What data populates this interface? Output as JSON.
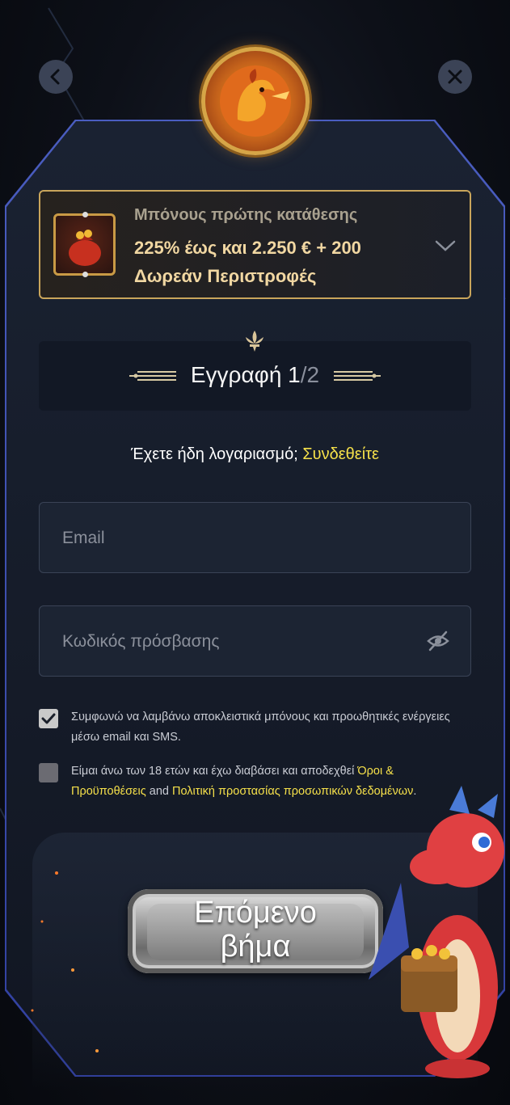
{
  "header": {
    "back_icon": "chevron-left-icon",
    "close_icon": "close-icon",
    "medallion": "dragon-medallion"
  },
  "bonus": {
    "title": "Μπόνους πρώτης κατάθεσης",
    "line1": "225% έως και 2.250 € + 200",
    "line2": "Δωρεάν Περιστροφές",
    "expand_icon": "chevron-down-icon",
    "thumb_icon": "money-bag-icon"
  },
  "step": {
    "label": "Εγγραφή 1",
    "separator": "/",
    "total": "2"
  },
  "login": {
    "prompt": "Έχετε ήδη λογαριασμό;",
    "link": "Συνδεθείτε"
  },
  "form": {
    "email_placeholder": "Email",
    "password_placeholder": "Κωδικός πρόσβασης",
    "email_value": "",
    "password_value": ""
  },
  "consents": {
    "marketing": {
      "checked": true,
      "text": "Συμφωνώ να λαμβάνω αποκλειστικά μπόνους και προωθητικές ενέργειες μέσω email και SMS."
    },
    "terms": {
      "checked": false,
      "text_before": "Είμαι άνω των 18 ετών και έχω διαβάσει και αποδεχθεί ",
      "terms_link": "Όροι & Προϋποθέσεις",
      "and": " and ",
      "privacy_link": "Πολιτική προστασίας προσωπικών δεδομένων",
      "text_after": "."
    }
  },
  "actions": {
    "next_label": "Επόμενο βήμα"
  },
  "colors": {
    "accent_yellow": "#f5e04a",
    "gold_border": "#c9a55b",
    "panel_border": "#4a5dc0"
  }
}
